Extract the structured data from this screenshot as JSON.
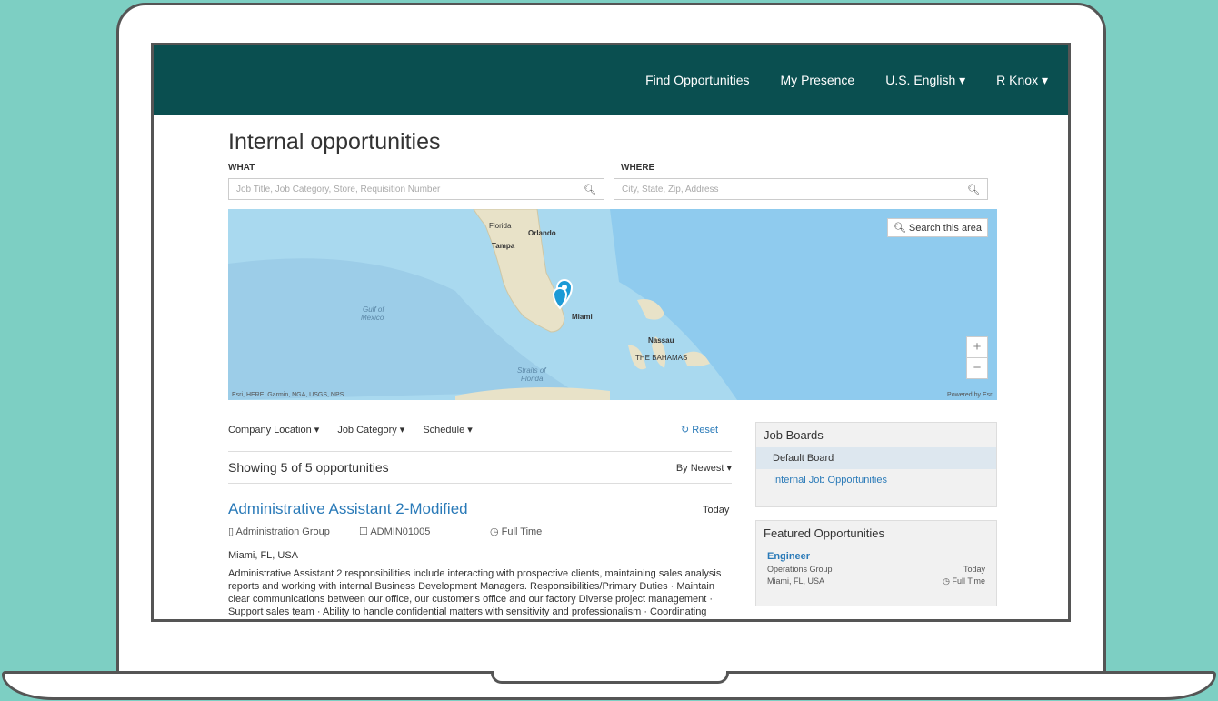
{
  "nav": {
    "find": "Find Opportunities",
    "presence": "My Presence",
    "language": "U.S. English ▾",
    "user": "R Knox ▾"
  },
  "page": {
    "title": "Internal opportunities",
    "what_label": "WHAT",
    "where_label": "WHERE",
    "what_placeholder": "Job Title, Job Category, Store, Requisition Number",
    "where_placeholder": "City, State, Zip, Address"
  },
  "map": {
    "search_area": "Search this area",
    "zoom_in": "+",
    "zoom_out": "−",
    "attribution": "Esri, HERE, Garmin, NGA, USGS, NPS",
    "powered": "Powered by Esri",
    "labels": {
      "florida": "Florida",
      "orlando": "Orlando",
      "tampa": "Tampa",
      "gulf": "Gulf of",
      "mexico": "Mexico",
      "miami": "Miami",
      "nassau": "Nassau",
      "bahamas": "THE BAHAMAS",
      "straits": "Straits of",
      "straits2": "Florida"
    }
  },
  "filters": {
    "location": "Company Location ▾",
    "category": "Job Category ▾",
    "schedule": "Schedule ▾",
    "reset": "Reset"
  },
  "results": {
    "showing": "Showing 5 of 5 opportunities",
    "sort": "By Newest ▾"
  },
  "job": {
    "title": "Administrative Assistant 2-Modified",
    "date": "Today",
    "group": "Administration Group",
    "req": "ADMIN01005",
    "schedule": "Full Time",
    "location": "Miami, FL, USA",
    "description": "Administrative Assistant 2 responsibilities include interacting with prospective clients, maintaining sales analysis reports and working with internal Business Development Managers. Responsibilities/Primary Duties · Maintain clear communications between our office, our customer's office and our factory Diverse project management · Support sales team · Ability to handle confidential matters with sensitivity and professionalism · Coordinating"
  },
  "sidebar": {
    "boards_title": "Job Boards",
    "boards": [
      "Default Board",
      "Internal Job Opportunities"
    ],
    "featured_title": "Featured Opportunities",
    "featured": {
      "title": "Engineer",
      "group": "Operations Group",
      "date": "Today",
      "location": "Miami, FL, USA",
      "schedule": "Full Time"
    }
  }
}
